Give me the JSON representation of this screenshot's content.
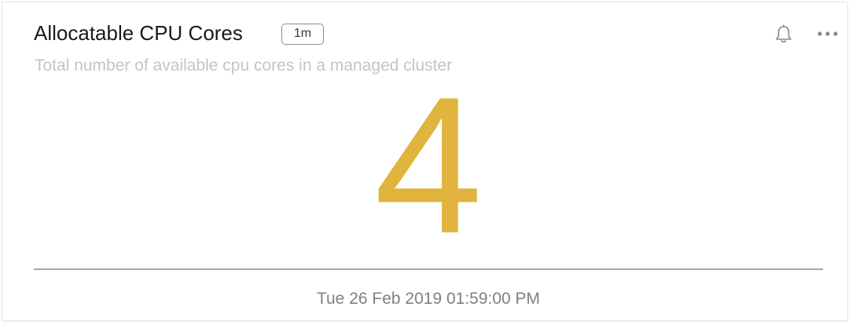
{
  "card": {
    "title": "Allocatable CPU Cores",
    "interval_badge": "1m",
    "description": "Total number of available cpu cores in a managed cluster",
    "value": "4",
    "timestamp": "Tue 26 Feb 2019 01:59:00 PM",
    "value_color": "#e0b43d"
  },
  "icons": {
    "alert": "bell-icon",
    "menu": "more-options-icon"
  }
}
